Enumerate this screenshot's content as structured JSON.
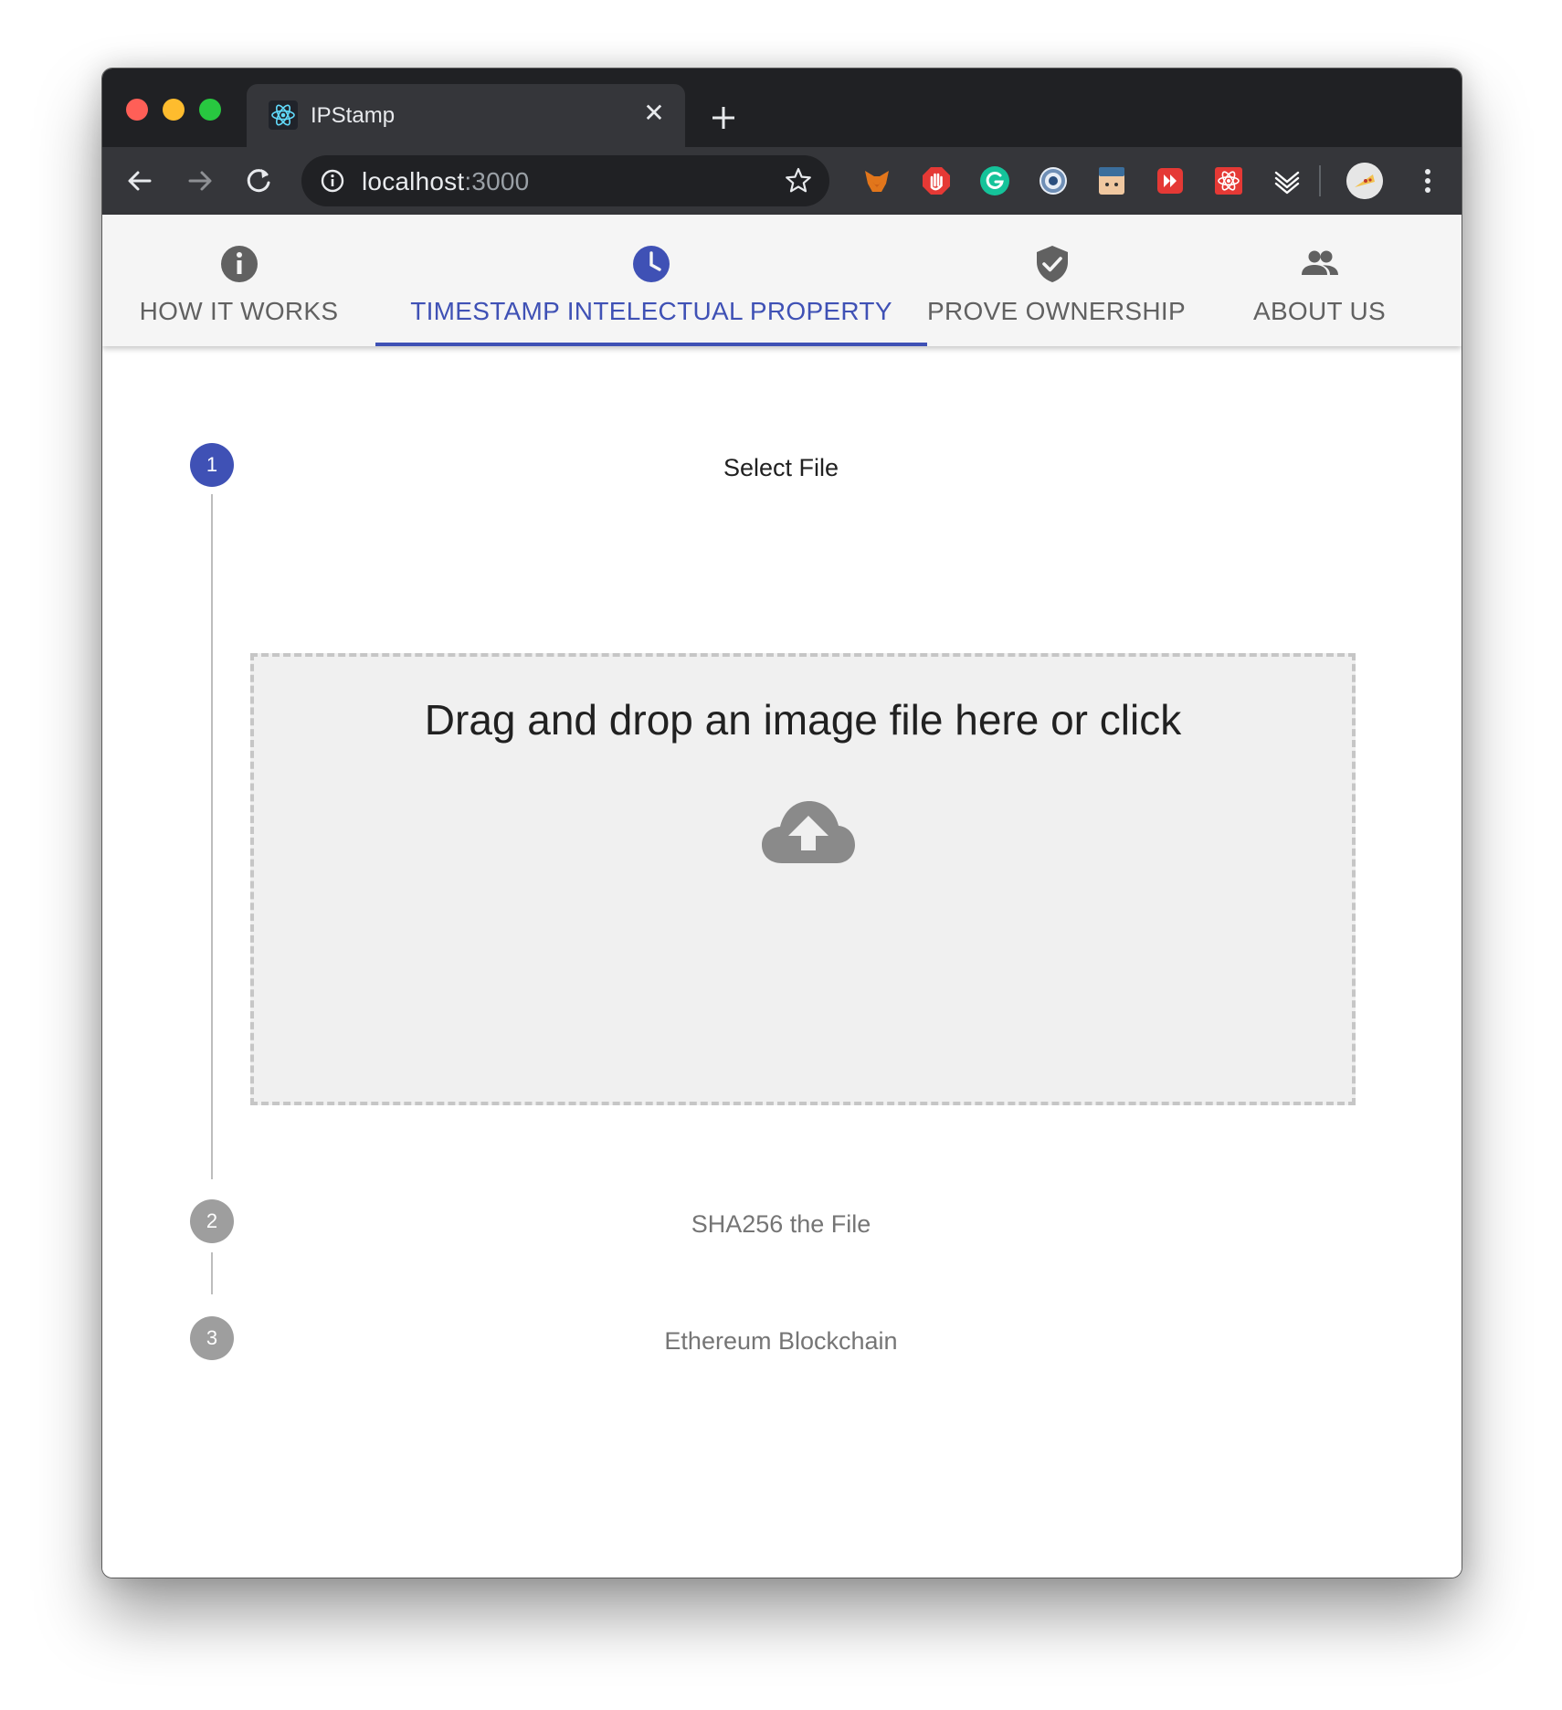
{
  "browser": {
    "tab_title": "IPStamp",
    "url_host": "localhost",
    "url_port": ":3000",
    "close_glyph": "✕"
  },
  "extensions": [
    {
      "name": "metamask-extension-icon",
      "color": "#e2761b"
    },
    {
      "name": "adblock-extension-icon",
      "color": "#e53935"
    },
    {
      "name": "grammarly-extension-icon",
      "color": "#15c39a"
    },
    {
      "name": "cache-extension-icon",
      "color": "#6f8fb6"
    },
    {
      "name": "face-extension-icon",
      "color": "#f0c8a0"
    },
    {
      "name": "forward-extension-icon",
      "color": "#e53935"
    },
    {
      "name": "react-devtools-extension-icon",
      "color": "#e53935"
    },
    {
      "name": "layers-extension-icon",
      "color": "#ffffff"
    }
  ],
  "nav": {
    "tabs": [
      {
        "label": "HOW IT WORKS",
        "icon": "info-icon",
        "active": false
      },
      {
        "label": "TIMESTAMP INTELECTUAL PROPERTY",
        "icon": "clock-icon",
        "active": true
      },
      {
        "label": "PROVE OWNERSHIP",
        "icon": "verified-shield-icon",
        "active": false
      },
      {
        "label": "ABOUT US",
        "icon": "people-icon",
        "active": false
      }
    ]
  },
  "stepper": {
    "steps": [
      {
        "number": "1",
        "label": "Select File",
        "state": "active"
      },
      {
        "number": "2",
        "label": "SHA256 the File",
        "state": "inactive"
      },
      {
        "number": "3",
        "label": "Ethereum Blockchain",
        "state": "inactive"
      }
    ]
  },
  "dropzone": {
    "text": "Drag and drop an image file here or click",
    "icon": "cloud-upload-icon"
  },
  "colors": {
    "primary": "#3f51b5",
    "inactive_step": "#9e9e9e",
    "tab_text": "#616161"
  }
}
